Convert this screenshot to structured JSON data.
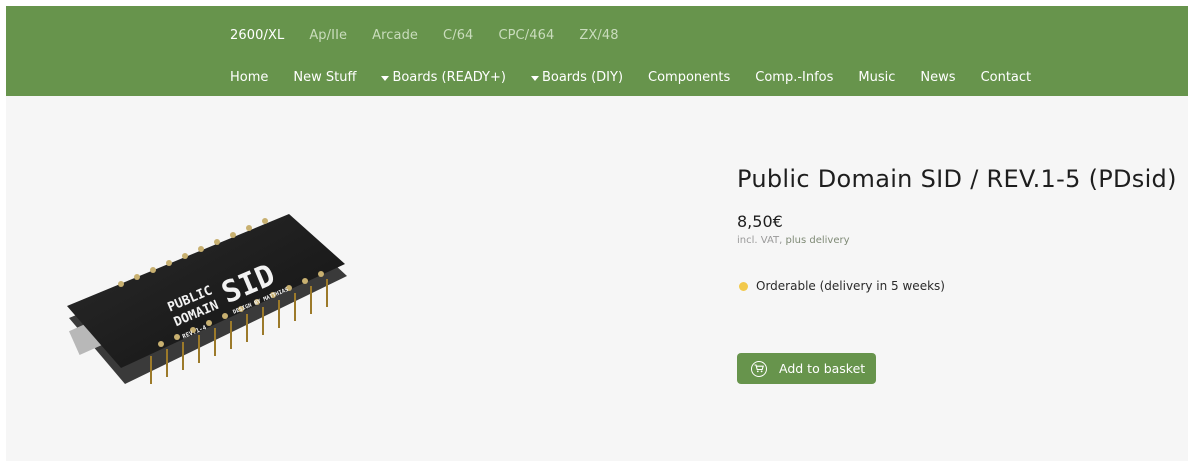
{
  "nav": {
    "platforms": [
      {
        "label": "2600/XL",
        "active": true
      },
      {
        "label": "Ap/IIe",
        "active": false
      },
      {
        "label": "Arcade",
        "active": false
      },
      {
        "label": "C/64",
        "active": false
      },
      {
        "label": "CPC/464",
        "active": false
      },
      {
        "label": "ZX/48",
        "active": false
      }
    ],
    "main": [
      {
        "label": "Home",
        "dropdown": false
      },
      {
        "label": "New Stuff",
        "dropdown": false
      },
      {
        "label": "Boards (READY+)",
        "dropdown": true
      },
      {
        "label": "Boards (DIY)",
        "dropdown": true
      },
      {
        "label": "Components",
        "dropdown": false
      },
      {
        "label": "Comp.-Infos",
        "dropdown": false
      },
      {
        "label": "Music",
        "dropdown": false
      },
      {
        "label": "News",
        "dropdown": false
      },
      {
        "label": "Contact",
        "dropdown": false
      }
    ]
  },
  "product": {
    "title": "Public Domain SID / REV.1-5 (PDsid)",
    "price": "8,50€",
    "vat_prefix": "incl. VAT,",
    "vat_link": "plus delivery",
    "availability": "Orderable (delivery in 5 weeks)",
    "basket_label": "Add to basket",
    "image": {
      "board_text_line1": "PUBLIC",
      "board_text_line2": "DOMAIN",
      "board_text_big": "SID",
      "board_text_credit": "DESIGN BY MATTHIAS",
      "board_text_rev": "REV.1-4"
    }
  },
  "colors": {
    "brand_green": "#67944c",
    "availability_dot": "#f2c94c",
    "page_bg": "#f6f6f6"
  },
  "icons": {
    "dropdown": "caret-down-icon",
    "basket": "shopping-cart-icon"
  }
}
